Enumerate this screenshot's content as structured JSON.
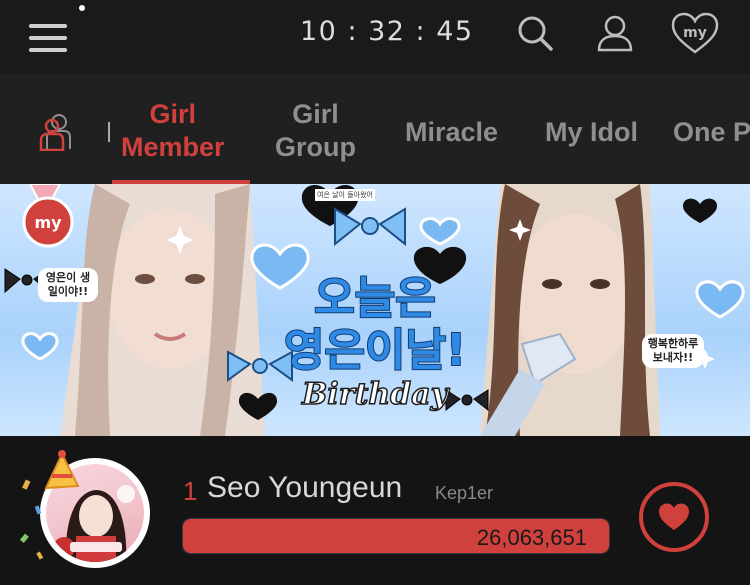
{
  "header": {
    "clock": "10 : 32 : 45",
    "icons": [
      "menu-icon",
      "search-icon",
      "user-icon",
      "my-heart-icon"
    ],
    "my_badge": "my"
  },
  "tabs": [
    {
      "line1": "Girl",
      "line2": "Member",
      "active": true
    },
    {
      "line1": "Girl",
      "line2": "Group",
      "active": false
    },
    {
      "label": "Miracle",
      "active": false
    },
    {
      "label": "My Idol",
      "active": false
    },
    {
      "label": "One P",
      "active": false
    }
  ],
  "banner": {
    "title_line1": "오늘은",
    "title_line2": "영은이날!",
    "title_line3": "Birthday",
    "bubble_left": "영은이 생일이야!!",
    "bubble_right": "행복한하루 보내자!!",
    "note": "여은 날이 돌아왔어",
    "badge": "my"
  },
  "ranking": {
    "rank": "1",
    "name": "Seo Youngeun",
    "group": "Kep1er",
    "votes": "26,063,651",
    "bar_fill_fraction": 1.0
  },
  "colors": {
    "accent": "#d0413d",
    "background": "#111111",
    "tab_inactive": "#8f8f8f"
  }
}
